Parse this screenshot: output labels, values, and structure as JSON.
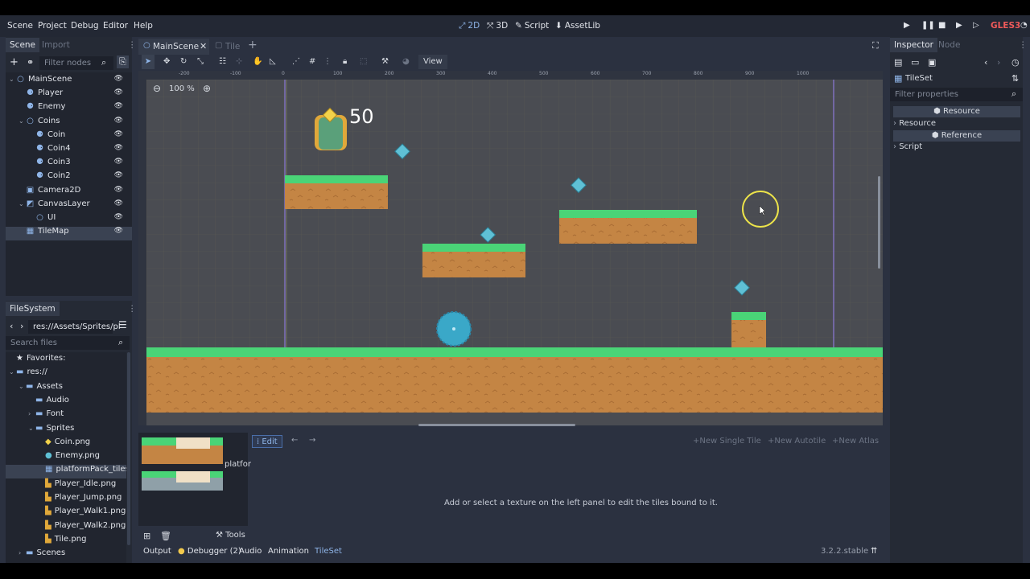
{
  "menu": [
    "Scene",
    "Project",
    "Debug",
    "Editor",
    "Help"
  ],
  "workspaces": [
    {
      "icon": "⤢",
      "label": "2D",
      "active": true
    },
    {
      "icon": "⤧",
      "label": "3D"
    },
    {
      "icon": "✎",
      "label": "Script"
    },
    {
      "icon": "⬇",
      "label": "AssetLib"
    }
  ],
  "renderer": "GLES3",
  "scene_dock": {
    "tabs": [
      "Scene",
      "Import"
    ],
    "filter_placeholder": "Filter nodes",
    "nodes": [
      {
        "name": "MainScene",
        "icon": "○",
        "depth": 0,
        "arrow": "⌄"
      },
      {
        "name": "Player",
        "icon": "⚈",
        "depth": 1
      },
      {
        "name": "Enemy",
        "icon": "⚈",
        "depth": 1
      },
      {
        "name": "Coins",
        "icon": "○",
        "depth": 1,
        "arrow": "⌄"
      },
      {
        "name": "Coin",
        "icon": "⚈",
        "depth": 2
      },
      {
        "name": "Coin4",
        "icon": "⚈",
        "depth": 2
      },
      {
        "name": "Coin3",
        "icon": "⚈",
        "depth": 2
      },
      {
        "name": "Coin2",
        "icon": "⚈",
        "depth": 2
      },
      {
        "name": "Camera2D",
        "icon": "▣",
        "depth": 1
      },
      {
        "name": "CanvasLayer",
        "icon": "◩",
        "depth": 1,
        "arrow": "⌄"
      },
      {
        "name": "UI",
        "icon": "○",
        "depth": 2
      },
      {
        "name": "TileMap",
        "icon": "▦",
        "depth": 1,
        "selected": true
      }
    ]
  },
  "filesystem": {
    "tab": "FileSystem",
    "path": "res://Assets/Sprites/pl",
    "search_placeholder": "Search files",
    "items": [
      {
        "name": "Favorites:",
        "icon": "★",
        "depth": 0
      },
      {
        "name": "res://",
        "icon": "▬",
        "depth": 0,
        "arrow": "⌄"
      },
      {
        "name": "Assets",
        "icon": "▬",
        "depth": 1,
        "arrow": "⌄"
      },
      {
        "name": "Audio",
        "icon": "▬",
        "depth": 2
      },
      {
        "name": "Font",
        "icon": "▬",
        "depth": 2,
        "arrow": "›"
      },
      {
        "name": "Sprites",
        "icon": "▬",
        "depth": 2,
        "arrow": "⌄"
      },
      {
        "name": "Coin.png",
        "icon": "◆",
        "depth": 3
      },
      {
        "name": "Enemy.png",
        "icon": "●",
        "depth": 3
      },
      {
        "name": "platformPack_tileshe",
        "icon": "▦",
        "depth": 3,
        "selected": true
      },
      {
        "name": "Player_Idle.png",
        "icon": "▙",
        "depth": 3
      },
      {
        "name": "Player_Jump.png",
        "icon": "▙",
        "depth": 3
      },
      {
        "name": "Player_Walk1.png",
        "icon": "▙",
        "depth": 3
      },
      {
        "name": "Player_Walk2.png",
        "icon": "▙",
        "depth": 3
      },
      {
        "name": "Tile.png",
        "icon": "▙",
        "depth": 3
      },
      {
        "name": "Scenes",
        "icon": "▬",
        "depth": 1,
        "arrow": "›"
      }
    ]
  },
  "editor_tabs": [
    "MainScene",
    "Tile"
  ],
  "viewport": {
    "view_menu": "View",
    "zoom": "100 %",
    "score": "50",
    "ruler_labels": [
      "-200",
      "-100",
      "0",
      "100",
      "200",
      "300",
      "400",
      "500",
      "600",
      "700",
      "800",
      "900",
      "1000"
    ]
  },
  "tileset_editor": {
    "thumb_label": "platfor",
    "edit_label": "Edit",
    "new_single_tile": "New Single Tile",
    "new_autotile": "New Autotile",
    "new_atlas": "New Atlas",
    "message": "Add or select a texture on the left panel to edit the tiles bound to it.",
    "tools_label": "Tools"
  },
  "bottom_tabs": [
    "Output",
    "Debugger (2)",
    "Audio",
    "Animation",
    "TileSet"
  ],
  "version": "3.2.2.stable",
  "inspector": {
    "tabs": [
      "Inspector",
      "Node"
    ],
    "object": "TileSet",
    "filter_placeholder": "Filter properties",
    "sections": [
      {
        "header": "Resource",
        "items": [
          "Resource"
        ]
      },
      {
        "header": "Reference",
        "items": [
          "Script"
        ]
      }
    ]
  },
  "colors": {
    "accent": "#8fb5e8",
    "grass": "#4ad477",
    "dirt": "#c17f45",
    "coin": "#5fc0d5",
    "gles": "#f05a5a"
  }
}
